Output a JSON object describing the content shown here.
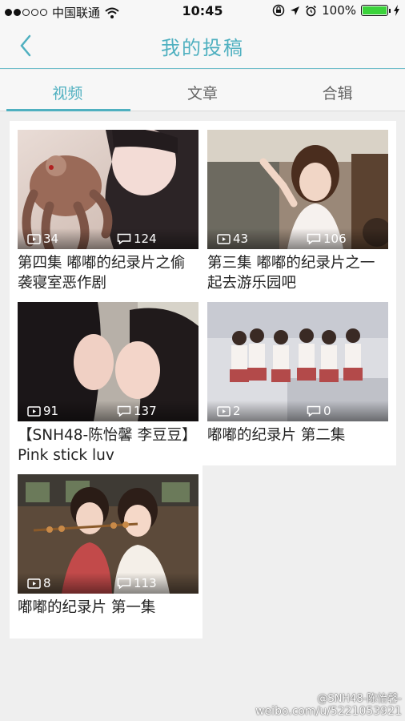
{
  "status_bar": {
    "carrier": "中国联通",
    "time": "10:45",
    "battery": "100%"
  },
  "nav": {
    "title": "我的投稿"
  },
  "tabs": [
    {
      "label": "视频",
      "active": true
    },
    {
      "label": "文章",
      "active": false
    },
    {
      "label": "合辑",
      "active": false
    }
  ],
  "videos": [
    {
      "title": "第四集 嘟嘟的纪录片之偷袭寝室恶作剧",
      "views": "34",
      "comments": "124"
    },
    {
      "title": "第三集 嘟嘟的纪录片之一起去游乐园吧",
      "views": "43",
      "comments": "106"
    },
    {
      "title": "【SNH48-陈怡馨 李豆豆】Pink stick luv",
      "views": "91",
      "comments": "137"
    },
    {
      "title": "嘟嘟的纪录片 第二集",
      "views": "2",
      "comments": "0"
    },
    {
      "title": "嘟嘟的纪录片 第一集",
      "views": "8",
      "comments": "113"
    }
  ],
  "watermark": {
    "handle": "@SNH48-陈怡馨-",
    "url": "weibo.com/u/5221053921"
  },
  "colors": {
    "accent": "#4fb0c0",
    "battery": "#3bd33b"
  }
}
